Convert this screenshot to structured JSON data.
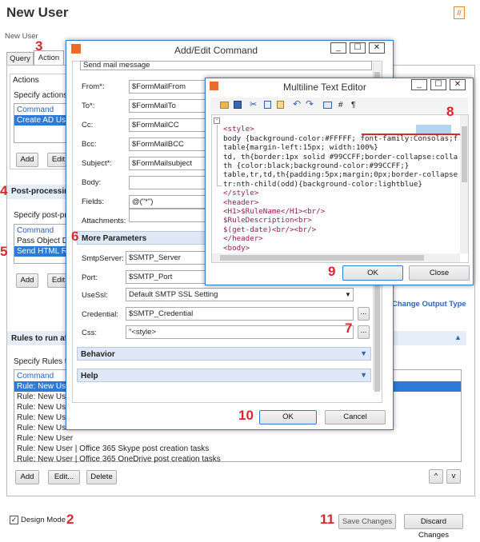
{
  "page": {
    "title": "New User",
    "breadcrumb": "New User",
    "tabs": [
      "Query",
      "Action"
    ],
    "actions_label": "Actions",
    "specify_actions": "Specify actions t",
    "actions_list": {
      "header": "Command",
      "items": [
        "Create AD User"
      ]
    },
    "btn_add": "Add",
    "btn_edit_short": "Edit",
    "post_processing": "Post-processing",
    "specify_post": "Specify post-pro",
    "post_list": {
      "header": "Command",
      "items": [
        "Pass Object Da",
        "Send HTML Rep"
      ]
    },
    "change_output": "Change Output Type",
    "rules_title": "Rules to run aft",
    "specify_rules": "Specify Rules to",
    "rules_list": {
      "header": "Command",
      "items": [
        "Rule: New User",
        "Rule: New User",
        "Rule: New User",
        "Rule: New User",
        "Rule: New User",
        "Rule: New User",
        "Rule: New User | Office 365 Skype post creation tasks",
        "Rule: New User | Office 365 OneDrive post creation tasks"
      ]
    },
    "btn_edit": "Edit...",
    "btn_delete": "Delete",
    "design_mode": "Design Mode",
    "save_changes": "Save Changes",
    "discard_changes": "Discard Changes"
  },
  "add_edit": {
    "title": "Add/Edit Command",
    "top_field": "Send mail message",
    "fields": [
      {
        "label": "From*:",
        "value": "$FormMailFrom"
      },
      {
        "label": "To*:",
        "value": "$FormMailTo"
      },
      {
        "label": "Cc:",
        "value": "$FormMailCC"
      },
      {
        "label": "Bcc:",
        "value": "$FormMailBCC"
      },
      {
        "label": "Subject*:",
        "value": "$FormMailsubject"
      },
      {
        "label": "Body:",
        "value": ""
      },
      {
        "label": "Fields:",
        "value": "@(\"*\")"
      },
      {
        "label": "Attachments:",
        "value": ""
      }
    ],
    "more_params": "More Parameters",
    "params": [
      {
        "label": "SmtpServer:",
        "value": "$SMTP_Server"
      },
      {
        "label": "Port:",
        "value": "$SMTP_Port"
      },
      {
        "label": "UseSsl:",
        "value": "Default SMTP SSL Setting"
      },
      {
        "label": "Credential:",
        "value": "$SMTP_Credential"
      },
      {
        "label": "Css:",
        "value": "\"<style>"
      }
    ],
    "behavior": "Behavior",
    "help": "Help",
    "ok": "OK",
    "cancel": "Cancel",
    "browse": "..."
  },
  "editor": {
    "title": "Multiline Text Editor",
    "hash": "#",
    "pilcrow": "¶",
    "ok": "OK",
    "close": "Close",
    "lines": [
      "<style>",
      "body {background-color:#FFFFF; font-family:Consolas;f",
      "table{margin-left:15px; width:100%}",
      "td, th{border:1px solid #99CCFF;border-collapse:colla",
      "th {color:black;background-color:#99CCFF;}",
      "table,tr,td,th{padding:5px;margin;0px;border-collapse",
      "tr:nth-child(odd){background-color:lightblue}",
      "</style>",
      "<header>",
      "<H1>$RuleName</H1><br/>",
      "$RuleDescription<br>",
      "$(get-date)<br/><br/>",
      "</header>",
      "<body>"
    ]
  },
  "callouts": [
    "2",
    "3",
    "4",
    "5",
    "6",
    "7",
    "8",
    "9",
    "10",
    "11"
  ],
  "colors": {
    "accent": "#2d7bd8",
    "callout": "#d9272e",
    "link": "#2b63b5"
  }
}
